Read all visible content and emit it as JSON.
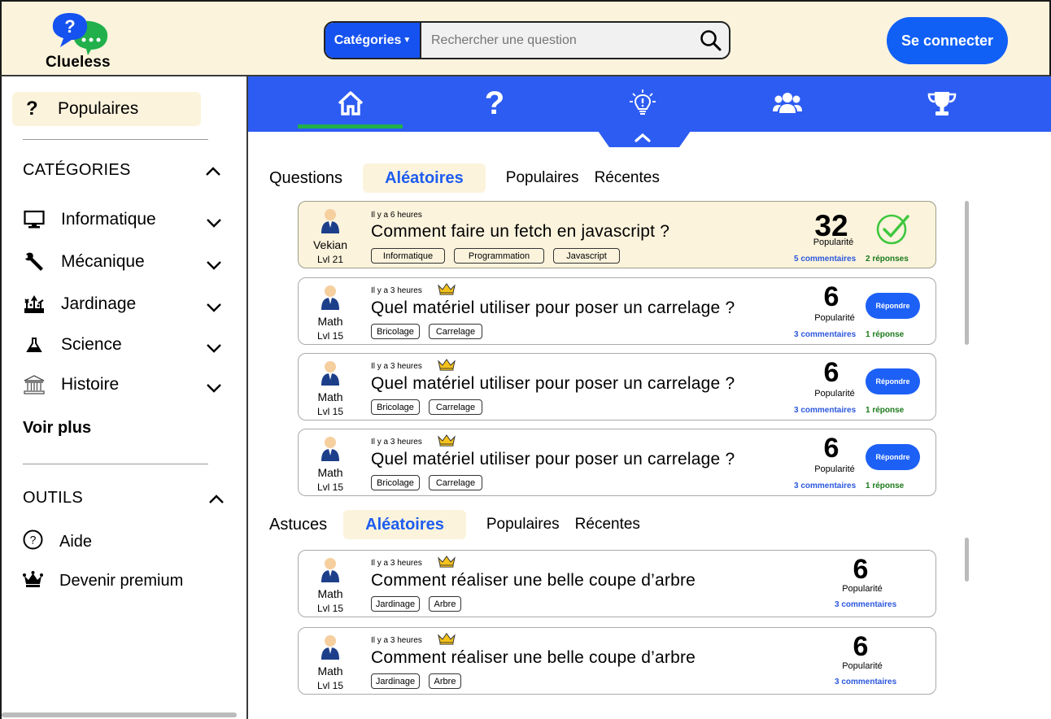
{
  "header": {
    "logo_text": "Clueless",
    "categories_label": "Catégories",
    "search_placeholder": "Rechercher une question",
    "login_label": "Se connecter"
  },
  "sidebar": {
    "populaires_label": "Populaires",
    "categories_title": "CATÉGORIES",
    "categories": [
      {
        "label": "Informatique",
        "icon": "monitor-icon"
      },
      {
        "label": "Mécanique",
        "icon": "wrench-icon"
      },
      {
        "label": "Jardinage",
        "icon": "garden-icon"
      },
      {
        "label": "Science",
        "icon": "flask-icon"
      },
      {
        "label": "Histoire",
        "icon": "museum-icon"
      }
    ],
    "voir_plus": "Voir plus",
    "tools_title": "OUTILS",
    "tools": [
      {
        "label": "Aide",
        "icon": "help-circle-icon"
      },
      {
        "label": "Devenir premium",
        "icon": "crown-icon"
      }
    ]
  },
  "nav": {
    "tabs": [
      "home-icon",
      "question-icon",
      "lightbulb-icon",
      "users-icon",
      "trophy-icon"
    ],
    "active": 0
  },
  "questions_section": {
    "title": "Questions",
    "tabs": [
      "Aléatoires",
      "Populaires",
      "Récentes"
    ],
    "active_tab": 0,
    "cards": [
      {
        "user": "Vekian",
        "level": "Lvl 21",
        "time": "Il y a 6 heures",
        "premium": false,
        "title": "Comment faire un fetch en javascript ?",
        "tags": [
          "Informatique",
          "Programmation",
          "Javascript"
        ],
        "score": "32",
        "pop_label": "Popularité",
        "comments": "5 commentaires",
        "answers": "2 réponses",
        "resolved": true
      },
      {
        "user": "Math",
        "level": "Lvl 15",
        "time": "Il y a 3 heures",
        "premium": true,
        "title": "Quel matériel utiliser pour poser un carrelage ?",
        "tags": [
          "Bricolage",
          "Carrelage"
        ],
        "score": "6",
        "pop_label": "Popularité",
        "comments": "3 commentaires",
        "answers": "1 réponse",
        "resolved": false,
        "answer_label": "Répondre"
      },
      {
        "user": "Math",
        "level": "Lvl 15",
        "time": "Il y a 3 heures",
        "premium": true,
        "title": "Quel matériel utiliser pour poser un carrelage ?",
        "tags": [
          "Bricolage",
          "Carrelage"
        ],
        "score": "6",
        "pop_label": "Popularité",
        "comments": "3 commentaires",
        "answers": "1 réponse",
        "resolved": false,
        "answer_label": "Répondre"
      },
      {
        "user": "Math",
        "level": "Lvl 15",
        "time": "Il y a 3 heures",
        "premium": true,
        "title": "Quel matériel utiliser pour poser un carrelage ?",
        "tags": [
          "Bricolage",
          "Carrelage"
        ],
        "score": "6",
        "pop_label": "Popularité",
        "comments": "3 commentaires",
        "answers": "1 réponse",
        "resolved": false,
        "answer_label": "Répondre"
      }
    ]
  },
  "tips_section": {
    "title": "Astuces",
    "tabs": [
      "Aléatoires",
      "Populaires",
      "Récentes"
    ],
    "active_tab": 0,
    "cards": [
      {
        "user": "Math",
        "level": "Lvl 15",
        "time": "Il y a 3 heures",
        "premium": true,
        "title": "Comment réaliser une belle coupe d’arbre",
        "tags": [
          "Jardinage",
          "Arbre"
        ],
        "score": "6",
        "pop_label": "Popularité",
        "comments": "3 commentaires"
      },
      {
        "user": "Math",
        "level": "Lvl 15",
        "time": "Il y a 3 heures",
        "premium": true,
        "title": "Comment réaliser une belle coupe d’arbre",
        "tags": [
          "Jardinage",
          "Arbre"
        ],
        "score": "6",
        "pop_label": "Popularité",
        "comments": "3 commentaires"
      }
    ]
  },
  "colors": {
    "accent_blue": "#1652f0",
    "nav_blue": "#2d5cf2",
    "cream": "#fbf3dc",
    "active_green": "#21b04b",
    "answer_green": "#1a7a1a"
  }
}
